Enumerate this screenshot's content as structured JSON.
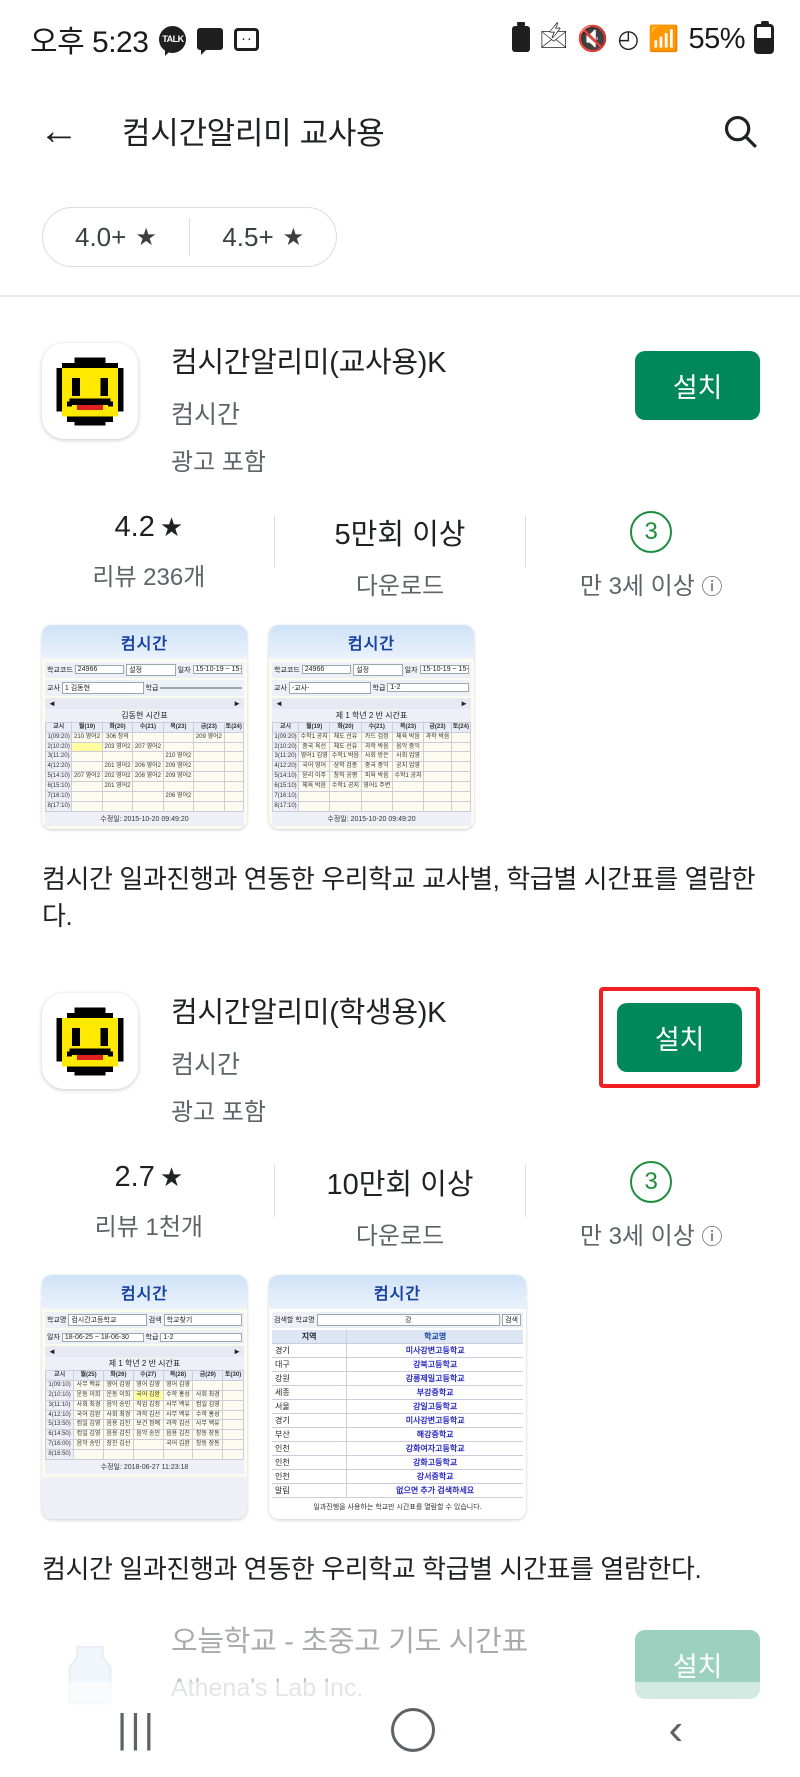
{
  "status_bar": {
    "time": "오후 5:23",
    "talk_label": "TALK",
    "battery_percent": "55%",
    "icons": [
      "kakaotalk-icon",
      "message-icon",
      "message-square-icon",
      "battery-saver-icon",
      "bluetooth-icon",
      "mute-vibrate-icon",
      "wifi-icon",
      "signal-icon",
      "battery-icon"
    ]
  },
  "app_bar": {
    "back_label": "←",
    "title": "컴시간알리미 교사용",
    "search_label": "검색"
  },
  "filters": {
    "chips": [
      {
        "label": "4.0+",
        "star": "★"
      },
      {
        "label": "4.5+",
        "star": "★"
      }
    ]
  },
  "apps": [
    {
      "title": "컴시간알리미(교사용)K",
      "developer": "컴시간",
      "ads": "광고 포함",
      "install_label": "설치",
      "highlighted": false,
      "rating": "4.2",
      "star": "★",
      "reviews": "리뷰 236개",
      "downloads": "5만회 이상",
      "downloads_label": "다운로드",
      "age_badge": "3",
      "age_label": "만 3세 이상",
      "info_icon": "ⓘ",
      "description": "컴시간 일과진행과 연동한 우리학교 교사별, 학급별 시간표를 열람한다.",
      "screenshots": [
        {
          "header": "컴시간",
          "controls": [
            {
              "label": "학교코드",
              "value": "24966"
            },
            {
              "label": "설정",
              "value": ""
            },
            {
              "label": "일자",
              "value": "15-10-19 ~ 15-10-24"
            },
            {
              "label": "교사",
              "value": "1 김동현"
            },
            {
              "label": "학급",
              "value": ""
            }
          ],
          "table_title": "김동현 시간표",
          "columns": [
            "교시",
            "월(19)",
            "화(20)",
            "수(21)",
            "목(23)",
            "금(23)",
            "토(24)"
          ],
          "rows": [
            [
              "1(09:20)",
              "210 영어2",
              "306 창의",
              "",
              "",
              "209 영어2",
              ""
            ],
            [
              "2(10:20)",
              "",
              "203 영어2",
              "207 영어2",
              "",
              "",
              ""
            ],
            [
              "3(11:20)",
              "",
              "",
              "",
              "",
              "210 영어2",
              ""
            ],
            [
              "4(12:20)",
              "",
              "201 영어2",
              "206 영어2",
              "209 영어2",
              "",
              ""
            ],
            [
              "5(14:10)",
              "207 영어2",
              "202 영어2",
              "208 영어2",
              "209 영어2",
              "",
              ""
            ],
            [
              "6(15:10)",
              "",
              "201 영어2",
              "",
              "",
              "",
              ""
            ],
            [
              "7(16:10)",
              "",
              "",
              "",
              "206 영어2",
              "",
              ""
            ],
            [
              "8(17:10)",
              "",
              "",
              "",
              "",
              "",
              ""
            ]
          ],
          "footer": "수정일: 2015-10-20 09:49:20"
        },
        {
          "header": "컴시간",
          "controls": [
            {
              "label": "학교코드",
              "value": "24966"
            },
            {
              "label": "설정",
              "value": ""
            },
            {
              "label": "일자",
              "value": "15-10-19 ~ 15-10-24"
            },
            {
              "label": "교사",
              "value": "-교사-"
            },
            {
              "label": "학급",
              "value": "1-2"
            }
          ],
          "table_title": "제 1 학년 2 반 시간표",
          "columns": [
            "교시",
            "월(19)",
            "화(20)",
            "수(21)",
            "목(23)",
            "금(23)",
            "토(24)"
          ],
          "rows": [
            [
              "1(09:20)",
              "수학1 공지",
              "체도 선유",
              "카드 검정",
              "체육 박음",
              "과학 박음"
            ],
            [
              "2(10:20)",
              "중국 육선",
              "체도 선유",
              "과학 박음",
              "음악 중익"
            ],
            [
              "3(11:20)",
              "영어1 김영",
              "수학1 박음",
              "사회 방은",
              "사회 업영",
              "영어1 방은"
            ],
            [
              "4(12:20)",
              "국어 영어",
              "상학 검종",
              "중국 중익",
              "공지 업영",
              "영어1"
            ],
            [
              "5(14:10)",
              "윤리 이주",
              "창직 공평",
              "피육 박음",
              "수학1 공지",
              "체도 선유"
            ],
            [
              "6(15:10)",
              "체육 박음",
              "수학1 공지",
              "영어1 주변",
              "체도 선유"
            ],
            [
              "7(16:10)",
              "",
              "",
              "영어1 검영",
              "",
              "주영 주영"
            ],
            [
              "8(17:10)",
              "",
              "",
              "",
              "",
              ""
            ]
          ],
          "footer": "수정일: 2015-10-20 09:49:20"
        }
      ]
    },
    {
      "title": "컴시간알리미(학생용)K",
      "developer": "컴시간",
      "ads": "광고 포함",
      "install_label": "설치",
      "highlighted": true,
      "rating": "2.7",
      "star": "★",
      "reviews": "리뷰 1천개",
      "downloads": "10만회 이상",
      "downloads_label": "다운로드",
      "age_badge": "3",
      "age_label": "만 3세 이상",
      "info_icon": "ⓘ",
      "description": "컴시간 일과진행과 연동한 우리학교 학급별 시간표를 열람한다.",
      "screenshots": [
        {
          "header": "컴시간",
          "controls": [
            {
              "label": "학교명",
              "value": "컴시간고등학교"
            },
            {
              "label": "검색",
              "value": "학교찾기"
            },
            {
              "label": "일자",
              "value": "18-06-25 ~ 18-06-30"
            },
            {
              "label": "학급",
              "value": "1-2"
            }
          ],
          "table_title": "제 1 학년 2 반 시간표",
          "columns": [
            "교시",
            "월(25)",
            "화(26)",
            "수(27)",
            "목(28)",
            "금(29)",
            "토(30)"
          ],
          "rows": [
            [
              "1(09:10)",
              "사무 백유",
              "영어 김영",
              "영어 김영",
              "영어 김영",
              ""
            ],
            [
              "2(10:10)",
              "운동 이희",
              "운동 이희",
              "국어 김완",
              "수학 홍성",
              "사회 최경"
            ],
            [
              "3(11:10)",
              "사회 최경",
              "음악 송민",
              "직업 김정",
              "사무 백유",
              "컴일 김영"
            ],
            [
              "4(12:10)",
              "국어 김완",
              "사회 최경",
              "과학 김선",
              "사무 백유",
              "수학 홍성"
            ],
            [
              "5(13:50)",
              "컴일 김영",
              "음용 김진",
              "보건 정예",
              "과학 김선",
              "사무 백유"
            ],
            [
              "6(14:50)",
              "컴일 김영",
              "음용 김진",
              "음악 송민",
              "음용 김진",
              "창동 장동"
            ],
            [
              "7(16:00)",
              "음악 송민",
              "장진 김선",
              "",
              "국어 김완",
              "창동 장동"
            ],
            [
              "8(16:50)",
              "",
              "",
              "",
              "",
              ""
            ]
          ],
          "footer": "수정일: 2018-06-27 11:23:18"
        },
        {
          "header": "컴시간",
          "search_label": "검색할 학교명",
          "search_value": "강",
          "search_button": "검색",
          "columns": [
            "지역",
            "학교명"
          ],
          "rows": [
            [
              "경기",
              "미사강변고등학교"
            ],
            [
              "대구",
              "강북고등학교"
            ],
            [
              "강원",
              "강릉제일고등학교"
            ],
            [
              "세종",
              "부강중학교"
            ],
            [
              "서울",
              "강일고등학교"
            ],
            [
              "경기",
              "미사강변고등학교"
            ],
            [
              "부산",
              "해강중학교"
            ],
            [
              "인천",
              "강화여자고등학교"
            ],
            [
              "인천",
              "강화고등학교"
            ],
            [
              "인천",
              "강서중학교"
            ],
            [
              "알림",
              "없으면 추가 검색하세요"
            ]
          ],
          "note": "일과진행을 사용하는 학교만 시간표를 열람할 수 있습니다."
        }
      ]
    },
    {
      "title": "오늘학교 - 초중고 기도 시간표",
      "developer": "Athena's Lab Inc.",
      "install_label": "설치"
    }
  ],
  "nav_bar": {
    "recents_label": "|||",
    "home_label": "home",
    "back_label": "‹"
  }
}
